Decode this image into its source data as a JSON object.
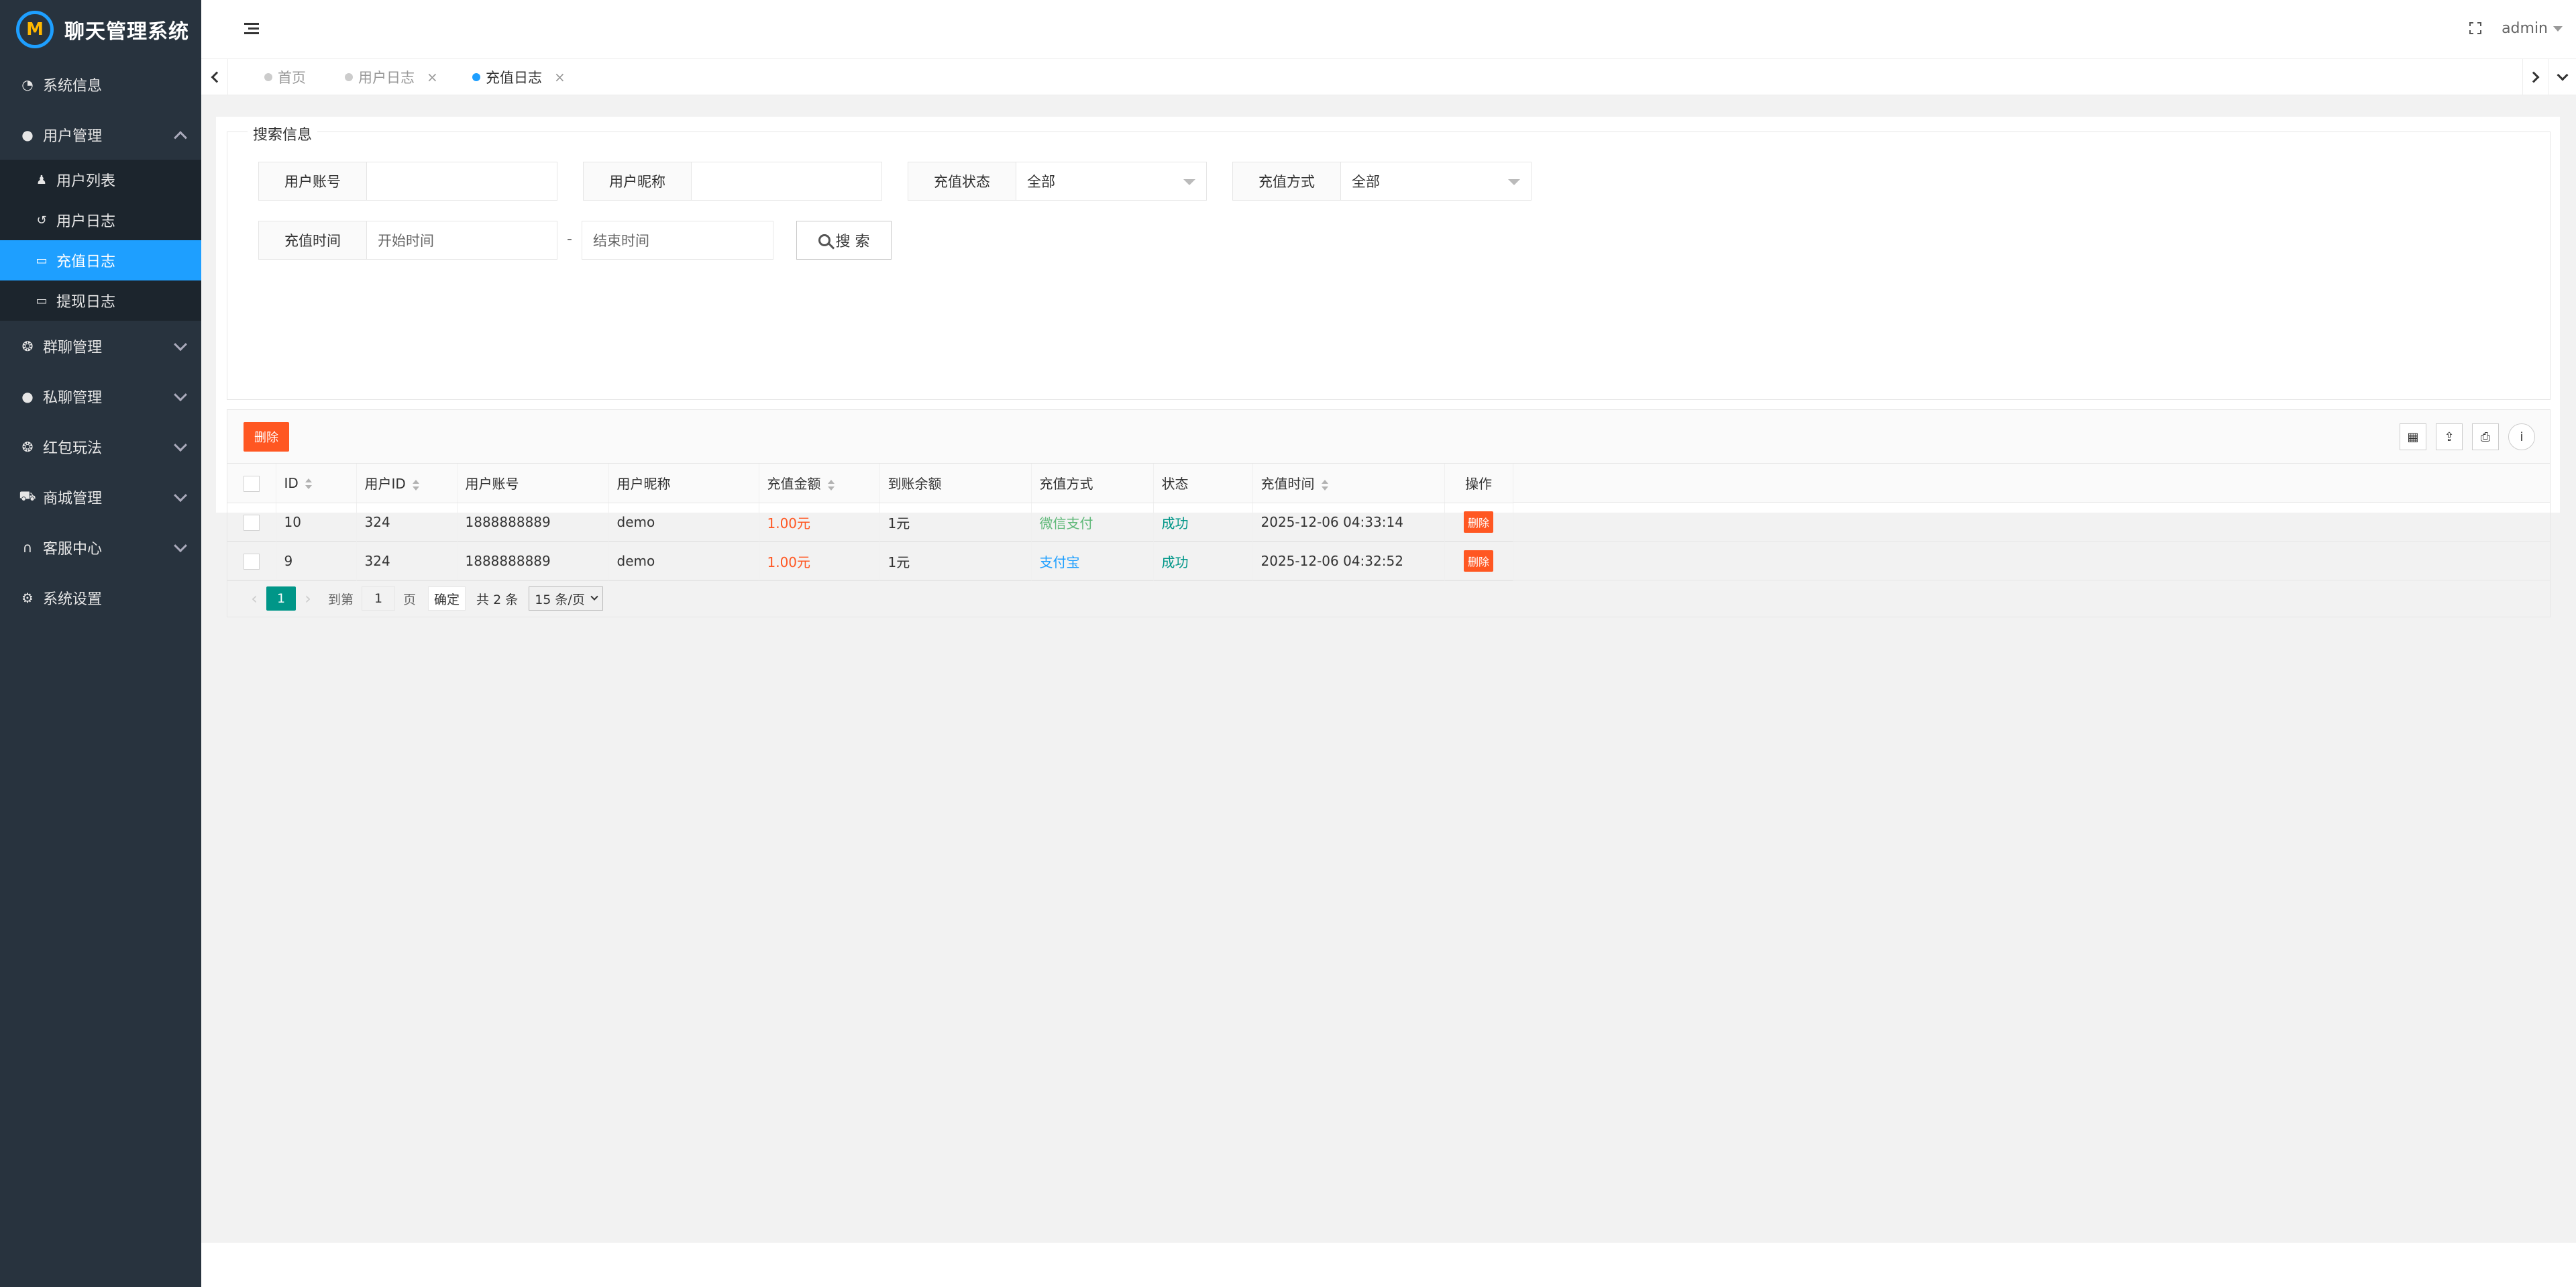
{
  "app": {
    "title": "聊天管理系统",
    "logo_mark": "M"
  },
  "sidebar": {
    "items": [
      {
        "label": "系统信息",
        "icon": "dashboard-icon"
      },
      {
        "label": "用户管理",
        "icon": "user-icon",
        "expanded": true,
        "children": [
          {
            "label": "用户列表",
            "icon": "users-icon"
          },
          {
            "label": "用户日志",
            "icon": "history-icon"
          },
          {
            "label": "充值日志",
            "icon": "card-icon",
            "active": true
          },
          {
            "label": "提现日志",
            "icon": "card-icon"
          }
        ]
      },
      {
        "label": "群聊管理",
        "icon": "wechat-icon"
      },
      {
        "label": "私聊管理",
        "icon": "chat-icon"
      },
      {
        "label": "红包玩法",
        "icon": "wechat-icon"
      },
      {
        "label": "商城管理",
        "icon": "cart-icon"
      },
      {
        "label": "客服中心",
        "icon": "headset-icon"
      },
      {
        "label": "系统设置",
        "icon": "gears-icon"
      }
    ]
  },
  "header": {
    "user": "admin"
  },
  "tabs": [
    {
      "label": "首页",
      "closable": false,
      "active": false
    },
    {
      "label": "用户日志",
      "closable": true,
      "active": false
    },
    {
      "label": "充值日志",
      "closable": true,
      "active": true
    }
  ],
  "search": {
    "legend": "搜索信息",
    "account_label": "用户账号",
    "account_value": "",
    "nickname_label": "用户昵称",
    "nickname_value": "",
    "status_label": "充值状态",
    "status_value": "全部",
    "method_label": "充值方式",
    "method_value": "全部",
    "time_label": "充值时间",
    "start_placeholder": "开始时间",
    "separator": "-",
    "end_placeholder": "结束时间",
    "button": "搜 索"
  },
  "toolbar": {
    "delete_label": "删除"
  },
  "table": {
    "columns": [
      "ID",
      "用户ID",
      "用户账号",
      "用户昵称",
      "充值金额",
      "到账余额",
      "充值方式",
      "状态",
      "充值时间",
      "操作"
    ],
    "rows": [
      {
        "id": "10",
        "uid": "324",
        "account": "1888888889",
        "nickname": "demo",
        "amount": "1.00元",
        "balance": "1元",
        "method": "微信支付",
        "status": "成功",
        "time": "2025-12-06 04:33:14",
        "action": "删除"
      },
      {
        "id": "9",
        "uid": "324",
        "account": "1888888889",
        "nickname": "demo",
        "amount": "1.00元",
        "balance": "1元",
        "method": "支付宝",
        "status": "成功",
        "time": "2025-12-06 04:32:52",
        "action": "删除"
      }
    ]
  },
  "pager": {
    "prev": "‹",
    "current": "1",
    "next": "›",
    "goto_label": "到第",
    "goto_value": "1",
    "page_unit": "页",
    "confirm": "确定",
    "total": "共 2 条",
    "limit": "15 条/页"
  },
  "colors": {
    "sidebar": "#28333e",
    "active": "#1e9fff",
    "danger": "#ff5722",
    "teal": "#009688",
    "green": "#5fb878"
  }
}
